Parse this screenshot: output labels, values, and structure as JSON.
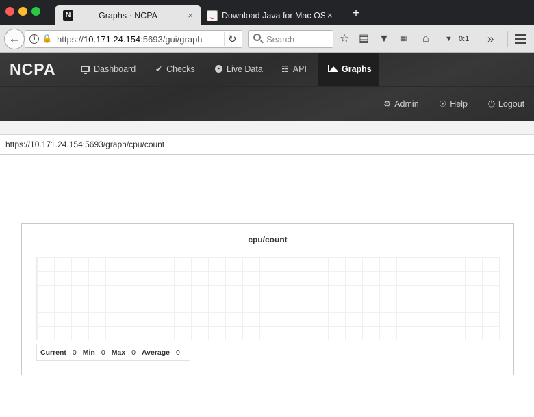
{
  "browser": {
    "tabs": [
      {
        "title": "Graphs · NCPA",
        "favicon": "N",
        "active": true
      },
      {
        "title": "Download Java for Mac OS X",
        "active": false
      }
    ],
    "close_glyph": "×",
    "newtab_glyph": "+",
    "url": {
      "prefix": "https://",
      "host": "10.171.24.154",
      "rest": ":5693/gui/graph"
    },
    "search_placeholder": "Search",
    "counter": "0:1"
  },
  "app": {
    "brand": "NCPA",
    "nav": [
      {
        "label": "Dashboard",
        "icon": "monitor-icon"
      },
      {
        "label": "Checks",
        "icon": "checkmark-icon"
      },
      {
        "label": "Live Data",
        "icon": "play-icon"
      },
      {
        "label": "API",
        "icon": "sitemap-icon"
      },
      {
        "label": "Graphs",
        "icon": "area-chart-icon",
        "active": true
      }
    ],
    "nav_right": [
      {
        "label": "Admin",
        "icon": "gear-icon"
      },
      {
        "label": "Help",
        "icon": "lifebuoy-icon"
      },
      {
        "label": "Logout",
        "icon": "power-icon"
      }
    ]
  },
  "page": {
    "status_url": "https://10.171.24.154:5693/graph/cpu/count",
    "graph": {
      "title": "cpu/count",
      "stats": {
        "current_label": "Current",
        "current": "0",
        "min_label": "Min",
        "min": "0",
        "max_label": "Max",
        "max": "0",
        "average_label": "Average",
        "average": "0"
      }
    }
  }
}
